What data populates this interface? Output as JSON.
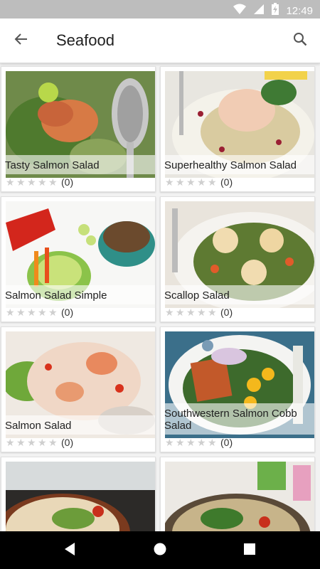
{
  "status_bar": {
    "time": "12:49",
    "icons": [
      "wifi-icon",
      "signal-icon",
      "battery-charging-icon"
    ]
  },
  "app_bar": {
    "title": "Seafood",
    "back_icon": "arrow-back-icon",
    "search_icon": "search-icon"
  },
  "recipes": [
    {
      "title": "Tasty Salmon Salad",
      "rating_count": "(0)"
    },
    {
      "title": "Superhealthy Salmon Salad",
      "rating_count": "(0)"
    },
    {
      "title": "Salmon Salad Simple",
      "rating_count": "(0)"
    },
    {
      "title": "Scallop Salad",
      "rating_count": "(0)"
    },
    {
      "title": "Salmon Salad",
      "rating_count": "(0)"
    },
    {
      "title": "Southwestern Salmon Cobb Salad",
      "rating_count": "(0)"
    },
    {
      "title": "",
      "rating_count": ""
    },
    {
      "title": "",
      "rating_count": ""
    }
  ],
  "nav_bar": {
    "icons": [
      "back-triangle-icon",
      "home-circle-icon",
      "recents-square-icon"
    ]
  },
  "colors": {
    "status_bar": "#bdbdbd",
    "app_bar": "#ffffff",
    "background": "#f2f2f2",
    "star_empty": "#cfcfcf",
    "nav_bar": "#000000"
  }
}
